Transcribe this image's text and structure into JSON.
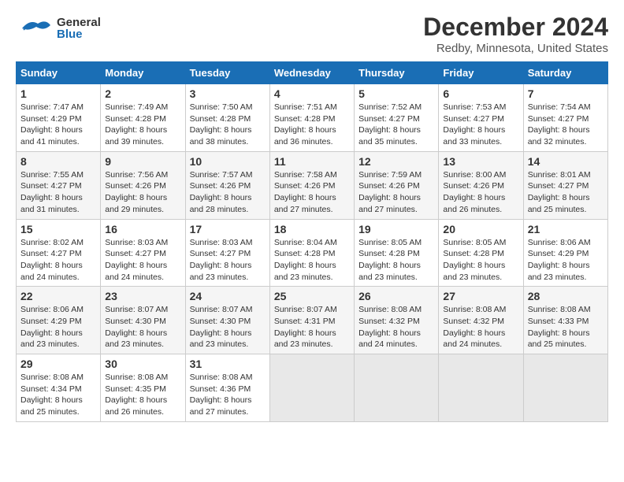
{
  "header": {
    "logo_general": "General",
    "logo_blue": "Blue",
    "title": "December 2024",
    "subtitle": "Redby, Minnesota, United States"
  },
  "calendar": {
    "headers": [
      "Sunday",
      "Monday",
      "Tuesday",
      "Wednesday",
      "Thursday",
      "Friday",
      "Saturday"
    ],
    "weeks": [
      [
        {
          "day": "",
          "empty": true
        },
        {
          "day": "",
          "empty": true
        },
        {
          "day": "",
          "empty": true
        },
        {
          "day": "",
          "empty": true
        },
        {
          "day": "",
          "empty": true
        },
        {
          "day": "",
          "empty": true
        },
        {
          "day": "",
          "empty": true
        }
      ],
      [
        {
          "day": "1",
          "sunrise": "7:47 AM",
          "sunset": "4:29 PM",
          "daylight": "8 hours and 41 minutes."
        },
        {
          "day": "2",
          "sunrise": "7:49 AM",
          "sunset": "4:28 PM",
          "daylight": "8 hours and 39 minutes."
        },
        {
          "day": "3",
          "sunrise": "7:50 AM",
          "sunset": "4:28 PM",
          "daylight": "8 hours and 38 minutes."
        },
        {
          "day": "4",
          "sunrise": "7:51 AM",
          "sunset": "4:28 PM",
          "daylight": "8 hours and 36 minutes."
        },
        {
          "day": "5",
          "sunrise": "7:52 AM",
          "sunset": "4:27 PM",
          "daylight": "8 hours and 35 minutes."
        },
        {
          "day": "6",
          "sunrise": "7:53 AM",
          "sunset": "4:27 PM",
          "daylight": "8 hours and 33 minutes."
        },
        {
          "day": "7",
          "sunrise": "7:54 AM",
          "sunset": "4:27 PM",
          "daylight": "8 hours and 32 minutes."
        }
      ],
      [
        {
          "day": "8",
          "sunrise": "7:55 AM",
          "sunset": "4:27 PM",
          "daylight": "8 hours and 31 minutes."
        },
        {
          "day": "9",
          "sunrise": "7:56 AM",
          "sunset": "4:26 PM",
          "daylight": "8 hours and 29 minutes."
        },
        {
          "day": "10",
          "sunrise": "7:57 AM",
          "sunset": "4:26 PM",
          "daylight": "8 hours and 28 minutes."
        },
        {
          "day": "11",
          "sunrise": "7:58 AM",
          "sunset": "4:26 PM",
          "daylight": "8 hours and 27 minutes."
        },
        {
          "day": "12",
          "sunrise": "7:59 AM",
          "sunset": "4:26 PM",
          "daylight": "8 hours and 27 minutes."
        },
        {
          "day": "13",
          "sunrise": "8:00 AM",
          "sunset": "4:26 PM",
          "daylight": "8 hours and 26 minutes."
        },
        {
          "day": "14",
          "sunrise": "8:01 AM",
          "sunset": "4:27 PM",
          "daylight": "8 hours and 25 minutes."
        }
      ],
      [
        {
          "day": "15",
          "sunrise": "8:02 AM",
          "sunset": "4:27 PM",
          "daylight": "8 hours and 24 minutes."
        },
        {
          "day": "16",
          "sunrise": "8:03 AM",
          "sunset": "4:27 PM",
          "daylight": "8 hours and 24 minutes."
        },
        {
          "day": "17",
          "sunrise": "8:03 AM",
          "sunset": "4:27 PM",
          "daylight": "8 hours and 23 minutes."
        },
        {
          "day": "18",
          "sunrise": "8:04 AM",
          "sunset": "4:28 PM",
          "daylight": "8 hours and 23 minutes."
        },
        {
          "day": "19",
          "sunrise": "8:05 AM",
          "sunset": "4:28 PM",
          "daylight": "8 hours and 23 minutes."
        },
        {
          "day": "20",
          "sunrise": "8:05 AM",
          "sunset": "4:28 PM",
          "daylight": "8 hours and 23 minutes."
        },
        {
          "day": "21",
          "sunrise": "8:06 AM",
          "sunset": "4:29 PM",
          "daylight": "8 hours and 23 minutes."
        }
      ],
      [
        {
          "day": "22",
          "sunrise": "8:06 AM",
          "sunset": "4:29 PM",
          "daylight": "8 hours and 23 minutes."
        },
        {
          "day": "23",
          "sunrise": "8:07 AM",
          "sunset": "4:30 PM",
          "daylight": "8 hours and 23 minutes."
        },
        {
          "day": "24",
          "sunrise": "8:07 AM",
          "sunset": "4:30 PM",
          "daylight": "8 hours and 23 minutes."
        },
        {
          "day": "25",
          "sunrise": "8:07 AM",
          "sunset": "4:31 PM",
          "daylight": "8 hours and 23 minutes."
        },
        {
          "day": "26",
          "sunrise": "8:08 AM",
          "sunset": "4:32 PM",
          "daylight": "8 hours and 24 minutes."
        },
        {
          "day": "27",
          "sunrise": "8:08 AM",
          "sunset": "4:32 PM",
          "daylight": "8 hours and 24 minutes."
        },
        {
          "day": "28",
          "sunrise": "8:08 AM",
          "sunset": "4:33 PM",
          "daylight": "8 hours and 25 minutes."
        }
      ],
      [
        {
          "day": "29",
          "sunrise": "8:08 AM",
          "sunset": "4:34 PM",
          "daylight": "8 hours and 25 minutes."
        },
        {
          "day": "30",
          "sunrise": "8:08 AM",
          "sunset": "4:35 PM",
          "daylight": "8 hours and 26 minutes."
        },
        {
          "day": "31",
          "sunrise": "8:08 AM",
          "sunset": "4:36 PM",
          "daylight": "8 hours and 27 minutes."
        },
        {
          "day": "",
          "empty": true
        },
        {
          "day": "",
          "empty": true
        },
        {
          "day": "",
          "empty": true
        },
        {
          "day": "",
          "empty": true
        }
      ]
    ]
  }
}
